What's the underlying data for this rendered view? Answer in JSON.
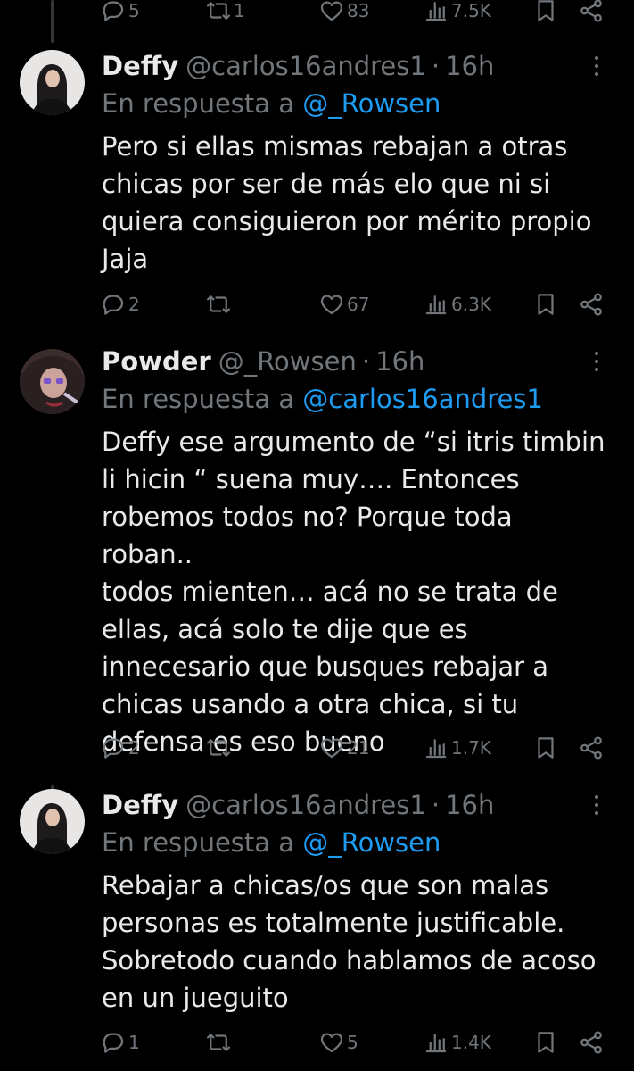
{
  "top_actions": {
    "replies": "5",
    "retweets": "1",
    "likes": "83",
    "views": "7.5K"
  },
  "tweets": [
    {
      "name": "Deffy",
      "handle": "@carlos16andres1",
      "time": "16h",
      "reply_prefix": "En respuesta a",
      "reply_to": "@_Rowsen",
      "text": "Pero si ellas mismas rebajan a otras\nchicas por ser de más elo que ni si\nquiera consiguieron por mérito propio\nJaja",
      "replies": "2",
      "retweets": "",
      "likes": "67",
      "views": "6.3K"
    },
    {
      "name": "Powder",
      "handle": "@_Rowsen",
      "time": "16h",
      "reply_prefix": "En respuesta a",
      "reply_to": "@carlos16andres1",
      "text": "Deffy ese argumento de “si itris timbin\nli hicin “ suena muy…. Entonces\nrobemos todos no? Porque toda roban..\ntodos mienten… acá no se trata de\nellas, acá solo te dije que es\ninnecesario que busques rebajar a\nchicas usando a otra chica, si tu\ndefensa es eso bueno",
      "replies": "2",
      "retweets": "",
      "likes": "21",
      "views": "1.7K"
    },
    {
      "name": "Deffy",
      "handle": "@carlos16andres1",
      "time": "16h",
      "reply_prefix": "En respuesta a",
      "reply_to": "@_Rowsen",
      "text": "Rebajar a chicas/os que son malas\npersonas es totalmente justificable.\nSobretodo cuando hablamos de acoso\nen un jueguito",
      "replies": "1",
      "retweets": "",
      "likes": "5",
      "views": "1.4K"
    }
  ],
  "colors": {
    "background": "#000000",
    "text": "#e7e9ea",
    "muted": "#71767b",
    "link": "#1d9bf0",
    "thread_line": "#333639"
  },
  "icons": [
    "reply-icon",
    "retweet-icon",
    "like-icon",
    "views-icon",
    "bookmark-icon",
    "share-icon",
    "more-icon"
  ]
}
